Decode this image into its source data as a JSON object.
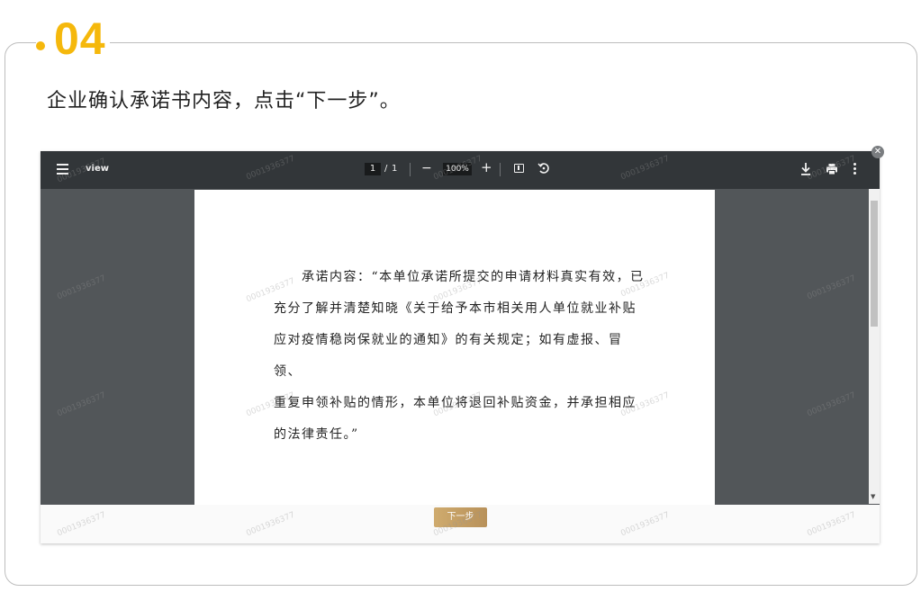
{
  "step": {
    "number": "04"
  },
  "instruction": "企业确认承诺书内容，点击“下一步”。",
  "viewer": {
    "title": "view",
    "page_current": "1",
    "page_separator": "/",
    "page_total": "1",
    "zoom_out": "−",
    "zoom_level": "100%",
    "zoom_in": "+",
    "close": "✕",
    "icons": [
      "menu-icon",
      "fit-page-icon",
      "rotate-icon",
      "download-icon",
      "print-icon",
      "more-options-icon",
      "close-icon"
    ]
  },
  "document": {
    "lines": [
      "　　承诺内容：“本单位承诺所提交的申请材料真实有效，已",
      "充分了解并清楚知晓《关于给予本市相关用人单位就业补贴",
      "应对疫情稳岗保就业的通知》的有关规定；如有虚报、冒领、",
      "重复申领补贴的情形，本单位将退回补贴资金，并承担相应",
      "的法律责任。”"
    ]
  },
  "next_button": "下一步",
  "watermark": "0001936377",
  "colors": {
    "accent": "#f5b80c",
    "toolbar": "#323639",
    "viewer_background": "#525659",
    "button_gold": "#c9a46a"
  }
}
